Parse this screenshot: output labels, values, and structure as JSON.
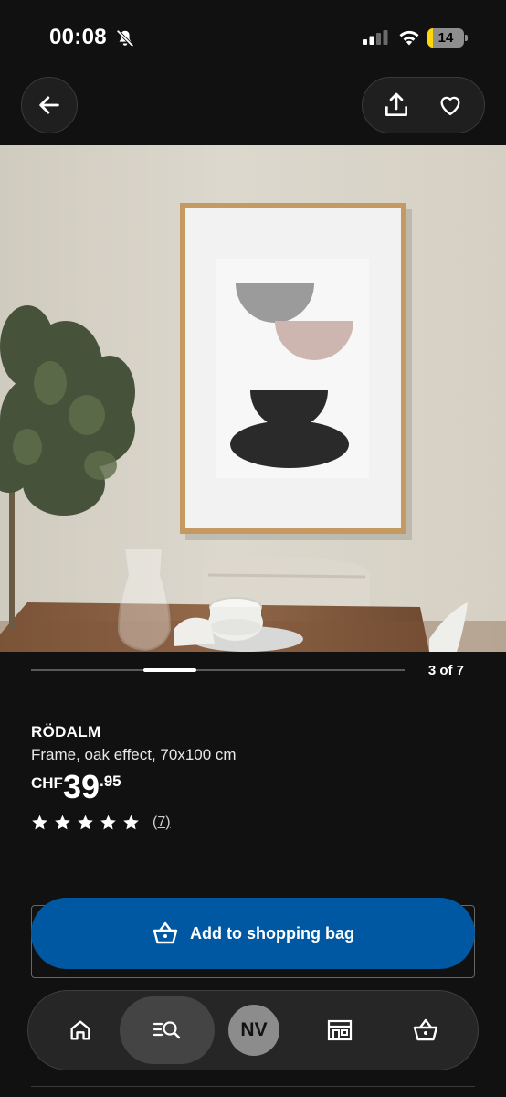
{
  "status_bar": {
    "time": "00:08",
    "battery_level": "14",
    "battery_fraction": 0.14
  },
  "nav": {
    "back_icon": "arrow-left-icon",
    "share_icon": "share-icon",
    "favorite_icon": "heart-icon"
  },
  "gallery": {
    "counter": "3 of 7",
    "current": 3,
    "total": 7
  },
  "product": {
    "name": "RÖDALM",
    "description": "Frame, oak effect, 70x100 cm",
    "price": {
      "currency": "CHF",
      "whole": "39",
      "decimal": ".95"
    },
    "rating": {
      "stars": 5,
      "review_count": "(7)"
    }
  },
  "cta": {
    "label": "Add to shopping bag",
    "icon": "shopping-bag-icon",
    "color": "#0058a3"
  },
  "tabbar": {
    "tabs": [
      {
        "name": "home",
        "icon": "home-icon"
      },
      {
        "name": "search",
        "icon": "search-list-icon",
        "active": true
      },
      {
        "name": "profile",
        "label": "NV"
      },
      {
        "name": "stores",
        "icon": "store-icon"
      },
      {
        "name": "bag",
        "icon": "shopping-bag-icon"
      }
    ]
  }
}
